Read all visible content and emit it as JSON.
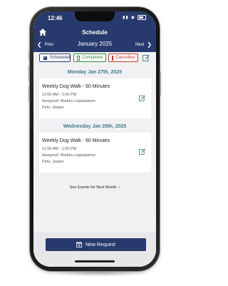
{
  "status_bar": {
    "time": "12:46"
  },
  "header": {
    "title": "Schedule",
    "prev_label": "Prev",
    "month": "January 2025",
    "next_label": "Next"
  },
  "filters": {
    "scheduled": "Scheduled",
    "completed": "Completed",
    "cancelled": "Cancelled"
  },
  "days": [
    {
      "date": "Monday Jan 27th, 2025",
      "event": {
        "title": "Weekly Dog Walk - 60 Minutes",
        "time": "11:00 AM - 1:00 PM",
        "assigned": "Assigned: Markku Lappalainen",
        "pets": "Pets: Jasper"
      }
    },
    {
      "date": "Wednesday Jan 29th, 2025",
      "event": {
        "title": "Weekly Dog Walk - 60 Minutes",
        "time": "11:00 AM - 1:00 PM",
        "assigned": "Assigned: Markku Lappalainen",
        "pets": "Pets: Jasper"
      }
    }
  ],
  "see_next": "See Events for Next Month",
  "new_request": "New Request",
  "colors": {
    "primary": "#283a6d",
    "accent_date": "#3e7b86",
    "completed": "#2e8b3a",
    "cancelled": "#c0392b"
  }
}
